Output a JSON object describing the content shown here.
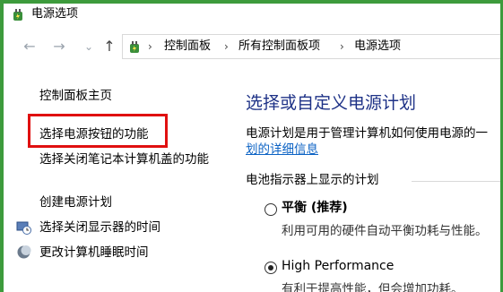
{
  "window": {
    "title": "电源选项"
  },
  "address_bar": {
    "breadcrumbs": [
      "控制面板",
      "所有控制面板项",
      "电源选项"
    ]
  },
  "nav_glyphs": {
    "back": "←",
    "forward": "→",
    "recent": "⌄",
    "up": "↑",
    "separator": "›"
  },
  "sidebar": {
    "home": "控制面板主页",
    "items": [
      {
        "label": "选择电源按钮的功能"
      },
      {
        "label": "选择关闭笔记本计算机盖的功能"
      },
      {
        "label": "创建电源计划"
      },
      {
        "label": "选择关闭显示器的时间"
      },
      {
        "label": "更改计算机睡眠时间"
      }
    ]
  },
  "main": {
    "heading": "选择或自定义电源计划",
    "description": "电源计划是用于管理计算机如何使用电源的一",
    "description_link": "划的详细信息",
    "section_title": "电池指示器上显示的计划",
    "plans": [
      {
        "name": "平衡 (推荐)",
        "description": "利用可用的硬件自动平衡功耗与性能。",
        "selected": false
      },
      {
        "name": "High Performance",
        "description": "有利于提高性能，但会增加功耗。",
        "selected": true
      }
    ]
  },
  "colors": {
    "window_border": "#3d9b3c",
    "heading": "#1e3287",
    "link": "#0b62c4",
    "highlight": "#e01010"
  }
}
